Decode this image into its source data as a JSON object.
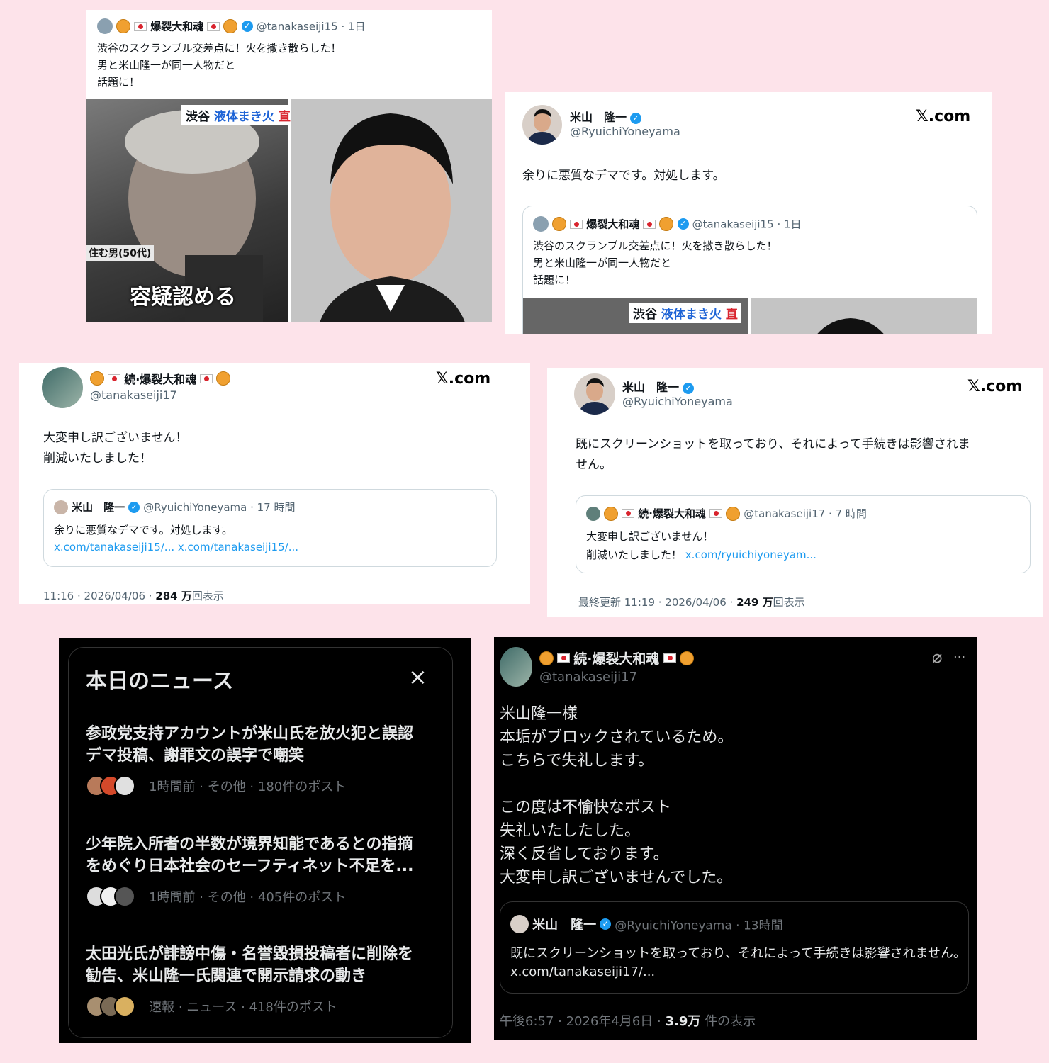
{
  "card1": {
    "display_name": "爆裂大和魂",
    "handle_time": "@tanakaseiji15 · 1日",
    "text_lines": [
      "渋谷のスクランブル交差点に！火を撒き散らした！",
      "男と米山隆一が同一人物だと",
      "話題に！"
    ],
    "photo_left_caption_top_a": "渋谷",
    "photo_left_caption_top_b": "液体まき火",
    "photo_left_caption_top_c": "直",
    "photo_left_caption_side": "住む男(50代)",
    "photo_left_caption_bottom": "容疑認める"
  },
  "card2": {
    "display_name": "米山　隆一",
    "handle": "@RyuichiYoneyama",
    "brand": "𝕏.com",
    "text": "余りに悪質なデマです。対処します。",
    "quote": {
      "display_name": "爆裂大和魂",
      "handle_time": "@tanakaseiji15 · 1日",
      "text_lines": [
        "渋谷のスクランブル交差点に！火を撒き散らした！",
        "男と米山隆一が同一人物だと",
        "話題に！"
      ],
      "photo_caption_a": "渋谷",
      "photo_caption_b": "液体まき火",
      "photo_caption_c": "直"
    }
  },
  "card3": {
    "display_name": "続·爆裂大和魂",
    "handle": "@tanakaseiji17",
    "brand": "𝕏.com",
    "text_lines": [
      "大変申し訳ございません！",
      "削減いたしました！"
    ],
    "quote": {
      "display_name": "米山　隆一",
      "handle_time": "@RyuichiYoneyama · 17 時間",
      "text": "余りに悪質なデマです。対処します。",
      "links": "x.com/tanakaseiji15/... x.com/tanakaseiji15/..."
    },
    "footer_time": "11:16 · 2026/04/06 · ",
    "footer_views": "284 万",
    "footer_views_label": "回表示"
  },
  "card4": {
    "display_name": "米山　隆一",
    "handle": "@RyuichiYoneyama",
    "brand": "𝕏.com",
    "text_lines": [
      "既にスクリーンショットを取っており、それによって手続きは影響されま",
      "せん。"
    ],
    "quote": {
      "display_name": "続·爆裂大和魂",
      "handle_time": "@tanakaseiji17 · 7 時間",
      "text_line1": "大変申し訳ございません！",
      "text_line2": "削減いたしました！",
      "link": "x.com/ryuichiyoneyam..."
    },
    "footer_time": "最終更新 11:19 · 2026/04/06 · ",
    "footer_views": "249 万",
    "footer_views_label": "回表示"
  },
  "news": {
    "title": "本日のニュース",
    "close_icon": "×",
    "items": [
      {
        "headline_lines": [
          "参政党支持アカウントが米山氏を放火犯と誤認",
          "デマ投稿、謝罪文の誤字で嘲笑"
        ],
        "meta": "1時間前 · その他 · 180件のポスト"
      },
      {
        "headline_lines": [
          "少年院入所者の半数が境界知能であるとの指摘",
          "をめぐり日本社会のセーフティネット不足を..."
        ],
        "meta": "1時間前 · その他 · 405件のポスト"
      },
      {
        "headline_lines": [
          "太田光氏が誹謗中傷・名誉毀損投稿者に削除を",
          "勧告、米山隆一氏関連で開示請求の動き"
        ],
        "meta": "速報 · ニュース · 418件のポスト"
      }
    ]
  },
  "dark_post": {
    "display_name": "続·爆裂大和魂",
    "handle": "@tanakaseiji17",
    "more_icon": "···",
    "text_lines": [
      "米山隆一様",
      "本垢がブロックされているため。",
      "こちらで失礼します。",
      "",
      "この度は不愉快なポスト",
      "失礼いたしたした。",
      "深く反省しております。",
      "大変申し訳ございませんでした。"
    ],
    "quote": {
      "display_name": "米山　隆一",
      "handle_time": "@RyuichiYoneyama · 13時間",
      "text": "既にスクリーンショットを取っており、それによって手続きは影響されません。",
      "link": "x.com/tanakaseiji17/..."
    },
    "footer_time": "午後6:57 · 2026年4月6日 · ",
    "footer_views": "3.9万",
    "footer_views_label": " 件の表示"
  }
}
